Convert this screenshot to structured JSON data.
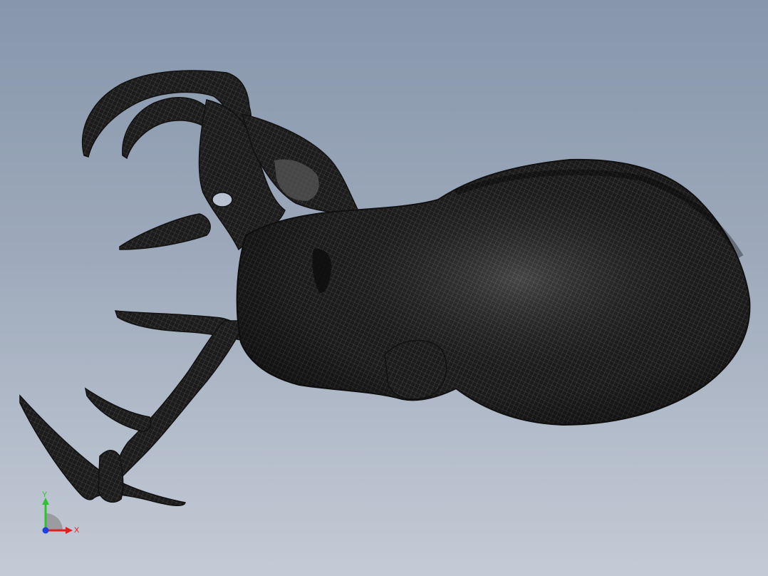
{
  "viewport": {
    "background_top": "#8796ac",
    "background_bottom": "#c4cbd6",
    "model_color": "#1c1c1c",
    "mesh_color": "#6a6a6a"
  },
  "triad": {
    "x_label": "X",
    "y_label": "Y",
    "x_color": "#e0201e",
    "y_color": "#2fc12f",
    "z_color": "#1f3fe0"
  }
}
